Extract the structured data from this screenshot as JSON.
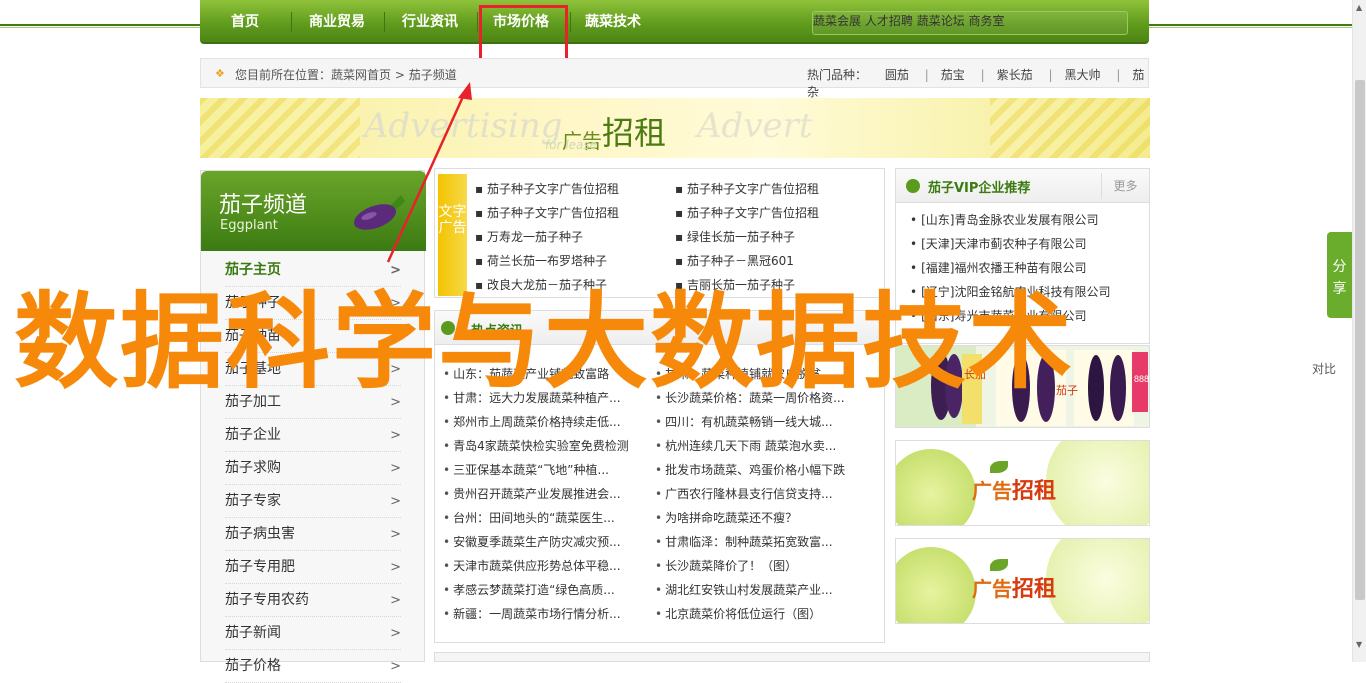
{
  "nav": {
    "items": [
      "首页",
      "商业贸易",
      "行业资讯",
      "市场价格",
      "蔬菜技术"
    ],
    "right_links": [
      "蔬菜会展",
      "人才招聘",
      "蔬菜论坛",
      "商务室"
    ]
  },
  "breadcrumb": {
    "prefix": "您目前所在位置：",
    "home": "蔬菜网首页",
    "sep": ">",
    "current": "茄子频道",
    "hot_label": "热门品种：",
    "hot_items": [
      "圆茄",
      "茄宝",
      "紫长茄",
      "黑大帅",
      "茄杂"
    ]
  },
  "banner": {
    "en1": "Advertising",
    "zh_small": "广告",
    "zh_big": "招租",
    "en_sub": "for lease",
    "en2": "Advert"
  },
  "sidebar": {
    "title": "茄子频道",
    "subtitle": "Eggplant",
    "items": [
      "茄子主页",
      "茄子种子",
      "茄子种苗",
      "茄子基地",
      "茄子加工",
      "茄子企业",
      "茄子求购",
      "茄子专家",
      "茄子病虫害",
      "茄子专用肥",
      "茄子专用农药",
      "茄子新闻",
      "茄子价格"
    ],
    "chevron": ">"
  },
  "text_ads": {
    "label": "文字广告",
    "left": [
      "茄子种子文字广告位招租",
      "茄子种子文字广告位招租",
      "万寿龙一茄子种子",
      "荷兰长茄一布罗塔种子",
      "改良大龙茄－茄子种子"
    ],
    "right": [
      "茄子种子文字广告位招租",
      "茄子种子文字广告位招租",
      "绿佳长茄一茄子种子",
      "茄子种子－黑冠601",
      "吉丽长茄一茄子种子"
    ]
  },
  "hot_news": {
    "title": "热点资讯",
    "left": [
      "山东：茄蔬菜产业铺就致富路",
      "甘肃：远大力发展蔬菜种植产...",
      "郑州市上周蔬菜价格持续走低...",
      "青岛4家蔬菜快检实验室免费检测",
      "三亚保基本蔬菜“飞地”种植...",
      "贵州召开蔬菜产业发展推进会...",
      "台州：田间地头的“蔬菜医生...",
      "安徽夏季蔬菜生产防灾减灾预...",
      "天津市蔬菜供应形势总体平稳...",
      "孝感云梦蔬菜打造“绿色高质...",
      "新疆：一周蔬菜市场行情分析..."
    ],
    "right": [
      "甘肃：蔬菜种植铺就农户脱贫...",
      "长沙蔬菜价格：蔬菜一周价格资...",
      "四川：有机蔬菜畅销一线大城...",
      "杭州连续几天下雨 蔬菜泡水卖...",
      "批发市场蔬菜、鸡蛋价格小幅下跌",
      "广西农行隆林县支行信贷支持...",
      "为啥拼命吃蔬菜还不瘦？",
      "甘肃临泽：制种蔬菜拓宽致富...",
      "长沙蔬菜降价了！（图）",
      "湖北红安铁山村发展蔬菜产业...",
      "北京蔬菜价将低位运行（图）"
    ]
  },
  "vip": {
    "title": "茄子VIP企业推荐",
    "more": "更多",
    "companies": [
      "[山东]青岛金脉农业发展有限公司",
      "[天津]天津市蓟农种子有限公司",
      "[福建]福州农播王种苗有限公司",
      "[辽宁]沈阳金铭航农业科技有限公司",
      "[山东]寿光市蔬菜种业有限公司"
    ]
  },
  "product_labels": [
    "长茄",
    "茄子",
    "888"
  ],
  "ads": {
    "zh_small": "广告",
    "zh_big": "招租"
  },
  "share": "分享",
  "compare": "对比",
  "watermark": "数据科学与大数据技术",
  "colors": {
    "nav_green": "#5e9a1c",
    "accent_red": "#e8212a",
    "watermark": "#f7890a",
    "link_green": "#3a7a10"
  }
}
